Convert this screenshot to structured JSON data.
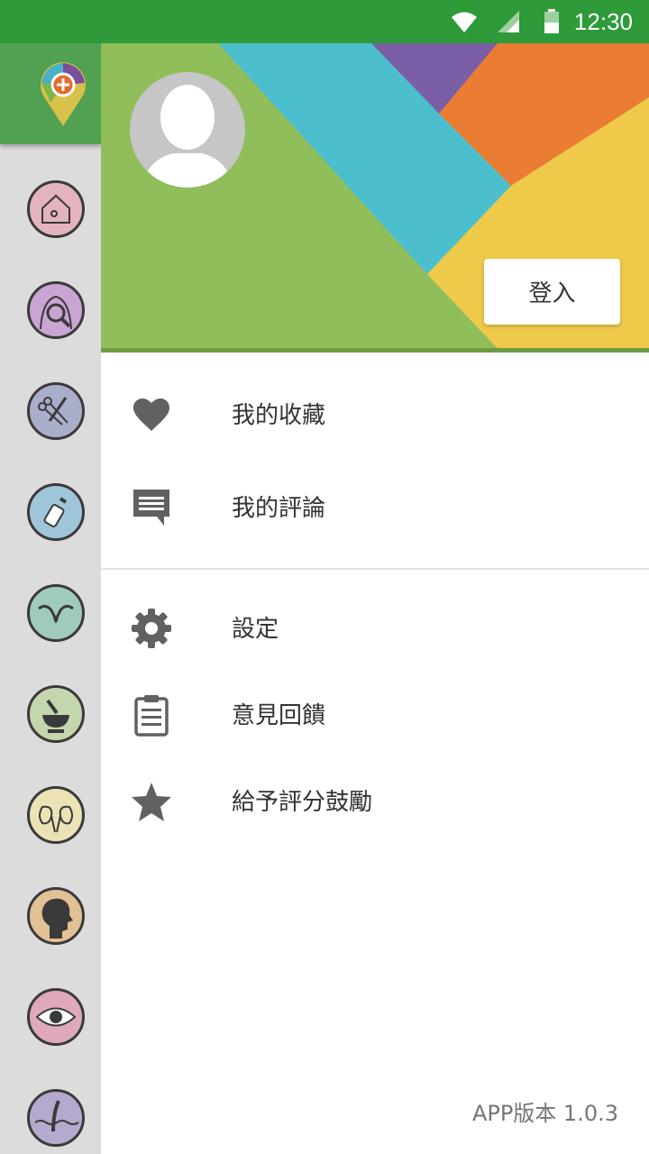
{
  "status_bar": {
    "time": "12:30"
  },
  "colors": {
    "status_bar": "#2e9a3a",
    "rail": "#dcdcdc",
    "rail_logo": "#52a052",
    "menu_icon": "#616161",
    "menu_text": "#333333"
  },
  "rail": {
    "categories": [
      {
        "name": "home",
        "color": "#e3b4bd"
      },
      {
        "name": "body-check",
        "color": "#c9a5d3"
      },
      {
        "name": "surgery",
        "color": "#a9aecb"
      },
      {
        "name": "pediatrics",
        "color": "#9fc6d8"
      },
      {
        "name": "gynecology",
        "color": "#9fcbbd"
      },
      {
        "name": "chinese-medicine",
        "color": "#c3d6ad"
      },
      {
        "name": "urology",
        "color": "#ebe3b5"
      },
      {
        "name": "ent",
        "color": "#e2c196"
      },
      {
        "name": "ophthalmology",
        "color": "#e0a9bb"
      },
      {
        "name": "dermatology",
        "color": "#b6a9ce"
      }
    ]
  },
  "header": {
    "login_label": "登入"
  },
  "menu": {
    "favorites": "我的收藏",
    "reviews": "我的評論",
    "settings": "設定",
    "feedback": "意見回饋",
    "rate": "給予評分鼓勵"
  },
  "footer": {
    "version": "APP版本 1.0.3"
  }
}
